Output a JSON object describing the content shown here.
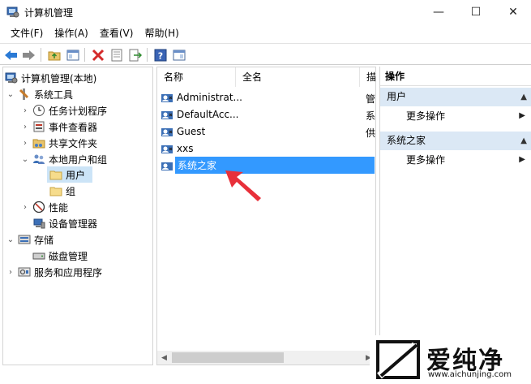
{
  "window": {
    "title": "计算机管理",
    "minimize": "—",
    "maximize": "☐",
    "close": "✕"
  },
  "menu": [
    "文件(F)",
    "操作(A)",
    "查看(V)",
    "帮助(H)"
  ],
  "tree": {
    "root": "计算机管理(本地)",
    "system_tools": "系统工具",
    "task_scheduler": "任务计划程序",
    "event_viewer": "事件查看器",
    "shared_folders": "共享文件夹",
    "local_users_groups": "本地用户和组",
    "users": "用户",
    "groups": "组",
    "performance": "性能",
    "device_manager": "设备管理器",
    "storage": "存储",
    "disk_management": "磁盘管理",
    "services_apps": "服务和应用程序"
  },
  "list": {
    "col_name": "名称",
    "col_fullname": "全名",
    "col_desc": "描",
    "rows": [
      {
        "name": "Administrat...",
        "desc": "管"
      },
      {
        "name": "DefaultAcc...",
        "desc": "系"
      },
      {
        "name": "Guest",
        "desc": "供"
      },
      {
        "name": "xxs",
        "desc": ""
      },
      {
        "name": "系统之家",
        "desc": ""
      }
    ]
  },
  "actions": {
    "header": "操作",
    "section1": "用户",
    "more1": "更多操作",
    "section2": "系统之家",
    "more2": "更多操作"
  },
  "watermark": {
    "text": "爱纯净",
    "url": "www.aichunjing.com"
  },
  "colors": {
    "selection": "#3399ff",
    "tree_selection": "#cce4f7",
    "action_section": "#dbe8f5",
    "arrow": "#e8303a"
  }
}
